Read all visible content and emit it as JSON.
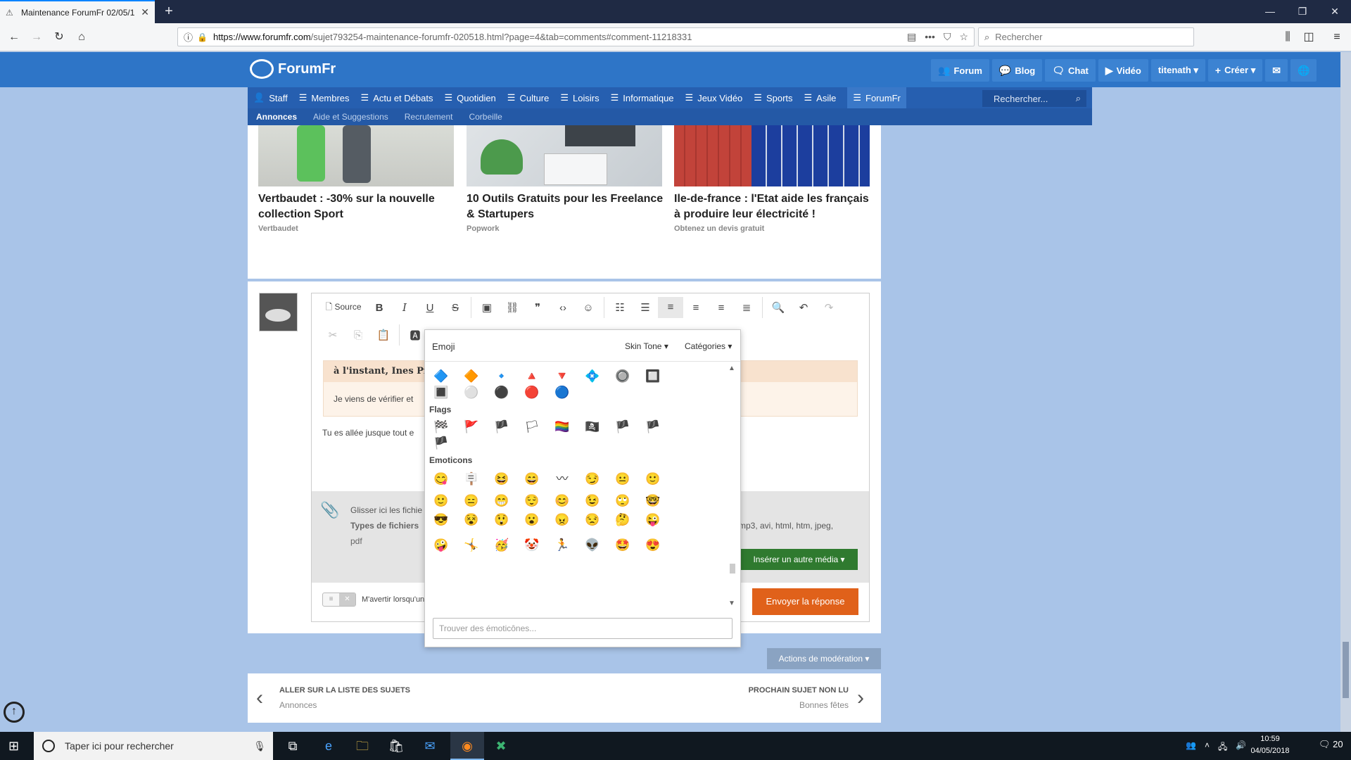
{
  "browser": {
    "tab_title": "Maintenance ForumFr 02/05/1",
    "url_host": "https://www.forumfr.com",
    "url_path": "/sujet793254-maintenance-forumfr-020518.html?page=4&tab=comments#comment-11218331",
    "search_placeholder": "Rechercher"
  },
  "site": {
    "logo_text": "ForumFr",
    "topnav": [
      {
        "icon": "users-icon",
        "label": "Forum"
      },
      {
        "icon": "speech-bubble-icon",
        "label": "Blog"
      },
      {
        "icon": "chat-icon",
        "label": "Chat"
      },
      {
        "icon": "play-icon",
        "label": "Vidéo"
      },
      {
        "icon": "",
        "label": "titenath ▾"
      },
      {
        "icon": "plus-icon",
        "label": "Créer ▾"
      }
    ],
    "categories": [
      "Staff",
      "Membres",
      "Actu et Débats",
      "Quotidien",
      "Culture",
      "Loisirs",
      "Informatique",
      "Jeux Vidéo",
      "Sports",
      "Asile",
      "ForumFr"
    ],
    "category_search_placeholder": "Rechercher...",
    "subcategories": [
      "Annonces",
      "Aide et Suggestions",
      "Recrutement",
      "Corbeille"
    ]
  },
  "ads": [
    {
      "title": "Vertbaudet : -30% sur la nouvelle collection Sport",
      "source": "Vertbaudet"
    },
    {
      "title": "10 Outils Gratuits pour les Freelance & Startupers",
      "source": "Popwork"
    },
    {
      "title": "Ile-de-france : l'Etat aide les français à produire leur électricité !",
      "source": "Obtenez un devis gratuit"
    }
  ],
  "editor": {
    "source_label": "Source",
    "quote_header": "à l'instant, Ines Pre",
    "quote_body": "Je viens de vérifier et",
    "reply_text": "Tu es allée jusque tout e",
    "drop_line1": "Glisser ici les fichie",
    "drop_line2": "Types de fichiers",
    "drop_line3": "pdf",
    "drop_types": "mp3, avi, html, htm, jpeg,",
    "insert_media": "Insérer un autre média ▾",
    "notify_text": "M'avertir lorsqu'un",
    "send": "Envoyer la réponse"
  },
  "emoji": {
    "title": "Emoji",
    "skin_tone": "Skin Tone ▾",
    "categories": "Catégories ▾",
    "flags_label": "Flags",
    "emoticons_label": "Emoticons",
    "search_placeholder": "Trouver des émoticônes...",
    "shapes_row1": [
      "🔷",
      "🔶",
      "🔹",
      "🔺",
      "🔻",
      "💠",
      "🔘",
      "🔲"
    ],
    "shapes_row2": [
      "🔳",
      "⚪",
      "⚫",
      "🔴",
      "🔵"
    ],
    "flags_row1": [
      "🏁",
      "🚩",
      "🏴",
      "🏳",
      "🏳️‍🌈",
      "🏴‍☠️",
      "🏴",
      "🏴"
    ],
    "flags_row2": [
      "🏴"
    ],
    "emoticons": [
      [
        "😋",
        "🪧",
        "😆",
        "😄",
        "〰",
        "😏",
        "😐",
        "🙂"
      ],
      [
        "🙂",
        "😑",
        "😁",
        "😌",
        "😊",
        "😉",
        "🙄",
        "🤓"
      ],
      [
        "😎",
        "😵",
        "😲",
        "😮",
        "😠",
        "😒",
        "🤔",
        "😜"
      ],
      [
        "🤪",
        "🤸",
        "🥳",
        "🤡",
        "🏃",
        "👽",
        "🤩",
        "😍"
      ]
    ]
  },
  "moderation": "Actions de modération ▾",
  "pagination": {
    "prev_title": "ALLER SUR LA LISTE DES SUJETS",
    "prev_sub": "Annonces",
    "next_title": "PROCHAIN SUJET NON LU",
    "next_sub": "Bonnes fêtes"
  },
  "taskbar": {
    "search_placeholder": "Taper ici pour rechercher",
    "time": "10:59",
    "date": "04/05/2018",
    "notif_count": "20"
  }
}
